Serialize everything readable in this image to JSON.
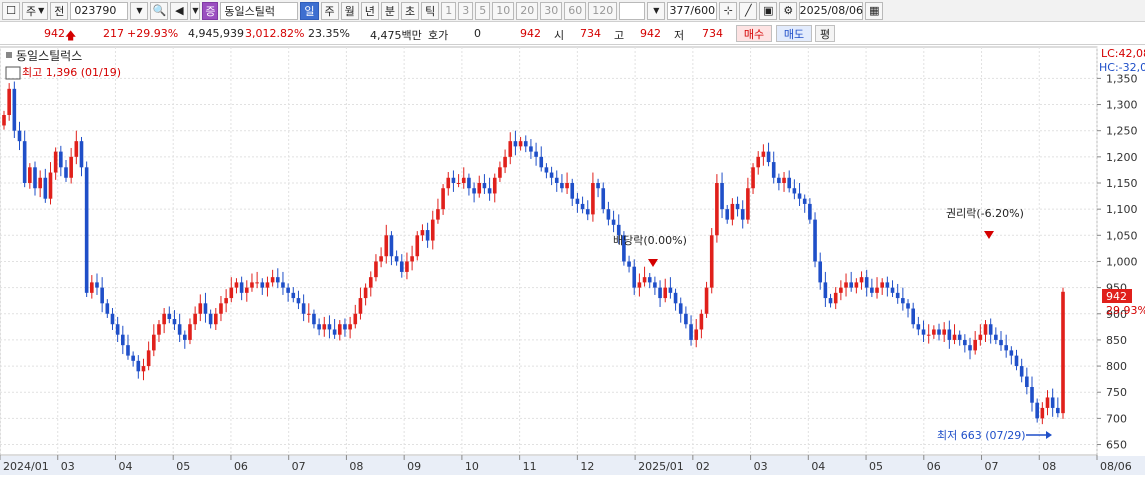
{
  "toolbar": {
    "period_unit": "주",
    "prev_label": "전",
    "code": "023790",
    "market_badge": "증",
    "stock_name": "동일스틸럭",
    "tabs": [
      "일",
      "주",
      "월",
      "년",
      "분",
      "초",
      "틱"
    ],
    "tick_numbers": [
      "1",
      "3",
      "5",
      "10",
      "20",
      "30",
      "60",
      "120"
    ],
    "count": "377/600",
    "date": "2025/08/06"
  },
  "quote": {
    "price": "942",
    "change": "217",
    "change_pct": "+29.93%",
    "volume": "4,945,939",
    "volume_pct": "3,012.82%",
    "turnover": "23.35%",
    "amount": "4,475백만",
    "hoga_label": "호가",
    "hoga_value": "0",
    "hoga_price": "942",
    "open_label": "시",
    "open": "734",
    "high_label": "고",
    "high": "942",
    "low_label": "저",
    "low": "734",
    "buy_label": "매수",
    "sell_label": "매도",
    "avg_label": "평"
  },
  "legend": {
    "name": "동일스틸럭스",
    "max_label": "최고 1,396 (01/19)",
    "min_label": "최저 663 (07/29)",
    "lc_label": "LC:42,08",
    "hc_label": "HC:-32,0",
    "last_price": "942",
    "last_pct": "29.93%",
    "dividend_note": "배당락(0.00%)",
    "rights_note": "권리락(-6.20%)"
  },
  "colors": {
    "up": "#e0201b",
    "down": "#1f4fc8"
  },
  "chart_data": {
    "type": "candlestick",
    "x_labels": [
      "2024/01",
      "03",
      "04",
      "05",
      "06",
      "07",
      "08",
      "09",
      "10",
      "11",
      "12",
      "2025/01",
      "02",
      "03",
      "04",
      "05",
      "06",
      "07",
      "08",
      "08/06"
    ],
    "y_ticks": [
      "1,350",
      "1,300",
      "1,250",
      "1,200",
      "1,150",
      "1,100",
      "1,050",
      "1,000",
      "950",
      "900",
      "850",
      "800",
      "750",
      "700",
      "650"
    ],
    "ylim": [
      630,
      1410
    ],
    "series": [
      {
        "values": [
          1280,
          1330,
          1250,
          1230,
          1150,
          1180,
          1140,
          1160,
          1120,
          1170,
          1210,
          1180,
          1160,
          1200,
          1230,
          1180,
          940,
          960,
          950,
          920,
          900,
          880,
          860,
          840,
          820,
          810,
          790,
          800,
          830,
          860,
          880,
          900,
          890,
          880,
          860,
          850,
          880,
          900,
          920,
          900,
          880,
          900,
          920,
          930,
          950,
          960,
          940,
          950,
          960,
          960,
          950,
          960,
          970,
          960,
          950,
          940,
          930,
          920,
          900,
          900,
          880,
          870,
          880,
          870,
          860,
          880,
          870,
          880,
          900,
          930,
          950,
          970,
          1000,
          1010,
          1050,
          1010,
          1000,
          980,
          1000,
          1010,
          1050,
          1060,
          1040,
          1080,
          1100,
          1140,
          1160,
          1150,
          1150,
          1160,
          1140,
          1130,
          1150,
          1140,
          1130,
          1160,
          1180,
          1200,
          1230,
          1220,
          1230,
          1220,
          1210,
          1200,
          1180,
          1170,
          1160,
          1150,
          1140,
          1150,
          1120,
          1110,
          1100,
          1090,
          1150,
          1140,
          1100,
          1080,
          1070,
          1050,
          1000,
          990,
          950,
          960,
          970,
          960,
          950,
          930,
          950,
          940,
          920,
          900,
          880,
          850,
          870,
          900,
          950,
          1050,
          1150,
          1100,
          1080,
          1110,
          1100,
          1080,
          1140,
          1180,
          1200,
          1210,
          1190,
          1160,
          1150,
          1160,
          1140,
          1130,
          1120,
          1110,
          1080,
          1000,
          960,
          930,
          920,
          940,
          950,
          960,
          950,
          960,
          970,
          950,
          940,
          950,
          960,
          950,
          940,
          930,
          920,
          910,
          880,
          870,
          860,
          860,
          870,
          860,
          870,
          850,
          860,
          850,
          840,
          830,
          850,
          860,
          880,
          860,
          850,
          840,
          830,
          820,
          800,
          780,
          760,
          730,
          700,
          720,
          740,
          720,
          710,
          942
        ]
      }
    ]
  }
}
